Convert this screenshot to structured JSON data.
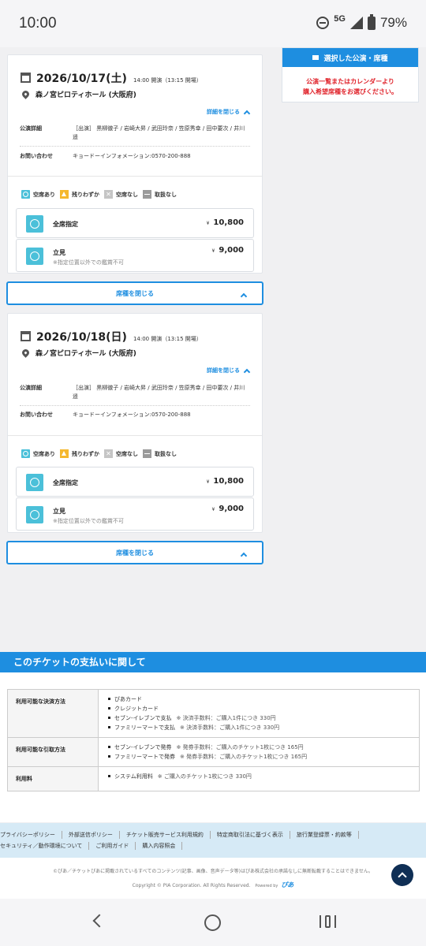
{
  "status_bar": {
    "time": "10:00",
    "network": "5G",
    "battery": "79%"
  },
  "selected_panel": {
    "title": "選択した公演・席種",
    "message_line1": "公演一覧またはカレンダーより",
    "message_line2": "購入希望席種をお選びください。"
  },
  "performances": [
    {
      "date": "2026/10/17(土)",
      "time": "14:00 開演（13:15 開場）",
      "venue": "森ノ宮ピロティホール (大阪府)",
      "detail_toggle": "詳細を閉じる",
      "info_label": "公演詳細",
      "info_value": "［出演］ 黒柳徹子 / 岩崎大昇 / 武田玲奈 / 笠原秀幸 / 田中要次 / 井川遥",
      "contact_label": "お問い合わせ",
      "contact_value": "キョードーインフォメーション:0570-200-888",
      "seats": [
        {
          "name": "全席指定",
          "note": "",
          "yen": "¥",
          "price": "10,800"
        },
        {
          "name": "立見",
          "note": "※指定位置以外での鑑賞不可",
          "yen": "¥",
          "price": "9,000"
        }
      ],
      "close_label": "席種を閉じる"
    },
    {
      "date": "2026/10/18(日)",
      "time": "14:00 開演（13:15 開場）",
      "venue": "森ノ宮ピロティホール (大阪府)",
      "detail_toggle": "詳細を閉じる",
      "info_label": "公演詳細",
      "info_value": "［出演］ 黒柳徹子 / 岩崎大昇 / 武田玲奈 / 笠原秀幸 / 田中要次 / 井川遥",
      "contact_label": "お問い合わせ",
      "contact_value": "キョードーインフォメーション:0570-200-888",
      "seats": [
        {
          "name": "全席指定",
          "note": "",
          "yen": "¥",
          "price": "10,800"
        },
        {
          "name": "立見",
          "note": "※指定位置以外での鑑賞不可",
          "yen": "¥",
          "price": "9,000"
        }
      ],
      "close_label": "席種を閉じる"
    }
  ],
  "legend": {
    "available": "空席あり",
    "few": "残りわずか",
    "none": "空席なし",
    "na": "取扱なし"
  },
  "payment": {
    "heading": "このチケットの支払いに関して",
    "rows": [
      {
        "label": "利用可能な決済方法",
        "items": [
          {
            "text": "ぴあカード",
            "note": ""
          },
          {
            "text": "クレジットカード",
            "note": ""
          },
          {
            "text": "セブン-イレブンで支払",
            "note": "※ 決済手数料：ご購入1件につき 330円"
          },
          {
            "text": "ファミリーマートで支払",
            "note": "※ 決済手数料：ご購入1件につき 330円"
          }
        ]
      },
      {
        "label": "利用可能な引取方法",
        "items": [
          {
            "text": "セブン-イレブンで発券",
            "note": "※ 発券手数料：ご購入のチケット1枚につき 165円"
          },
          {
            "text": "ファミリーマートで発券",
            "note": "※ 発券手数料：ご購入のチケット1枚につき 165円"
          }
        ]
      },
      {
        "label": "利用料",
        "items": [
          {
            "text": "システム利用料",
            "note": "※ ご購入のチケット1枚につき 330円"
          }
        ]
      }
    ]
  },
  "footer": {
    "links_row1": [
      "プライバシーポリシー",
      "外部送信ポリシー",
      "チケット販売サービス利用規約",
      "特定商取引法に基づく表示",
      "旅行業登録票・約款等"
    ],
    "links_row2": [
      "セキュリティ／動作環境について",
      "ご利用ガイド",
      "購入内容照会"
    ],
    "legal": "©ぴあ／チケットぴあに掲載されているすべてのコンテンツ(記事、画像、音声データ等)はぴあ株式会社の承諾なしに無断転載することはできません。",
    "copyright": "Copyright © PIA Corporation. All Rights Reserved.",
    "powered_by": "Powered by",
    "logo_text": "ぴあ"
  },
  "icons": {
    "calendar": "calendar-icon",
    "pin": "location-pin-icon",
    "chevron_up": "chevron-up-icon",
    "seat_available": "seat-available-icon",
    "scroll_top": "scroll-to-top-icon"
  },
  "colors": {
    "accent": "#1e8ee0",
    "available": "#4bc0d9",
    "few": "#f5b82e",
    "warning_text": "#e0222a"
  }
}
